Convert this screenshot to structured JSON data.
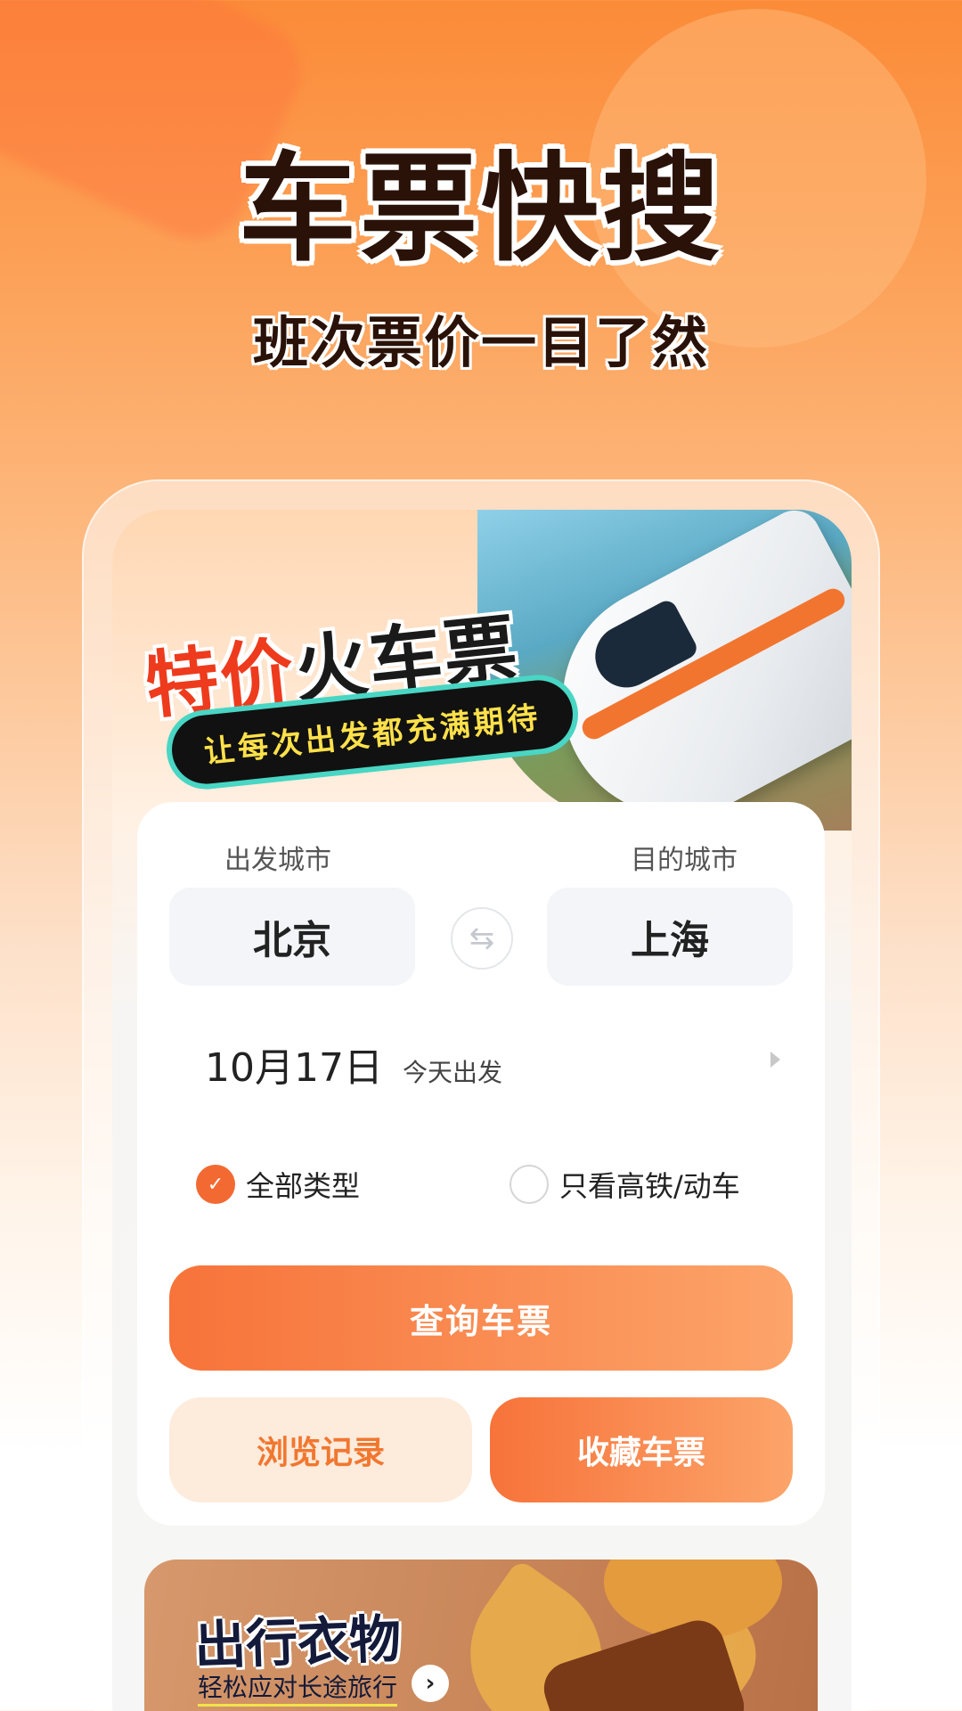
{
  "hero": {
    "title": "车票快搜",
    "subtitle": "班次票价一目了然"
  },
  "banner": {
    "headline_red": "特价",
    "headline_dark": "火车票",
    "tagline": "让每次出发都充满期待"
  },
  "search": {
    "from_label": "出发城市",
    "to_label": "目的城市",
    "from_city": "北京",
    "to_city": "上海",
    "swap_icon": "swap-arrows-icon",
    "date": "10月17日",
    "date_note": "今天出发",
    "filters": [
      {
        "label": "全部类型",
        "checked": true
      },
      {
        "label": "只看高铁/动车",
        "checked": false
      }
    ],
    "search_button": "查询车票",
    "history_button": "浏览记录",
    "favorite_button": "收藏车票"
  },
  "promo": {
    "title": "出行衣物",
    "subtitle": "轻松应对长途旅行"
  },
  "colors": {
    "accent": "#f7733a",
    "accent_light": "#fdebdc"
  }
}
